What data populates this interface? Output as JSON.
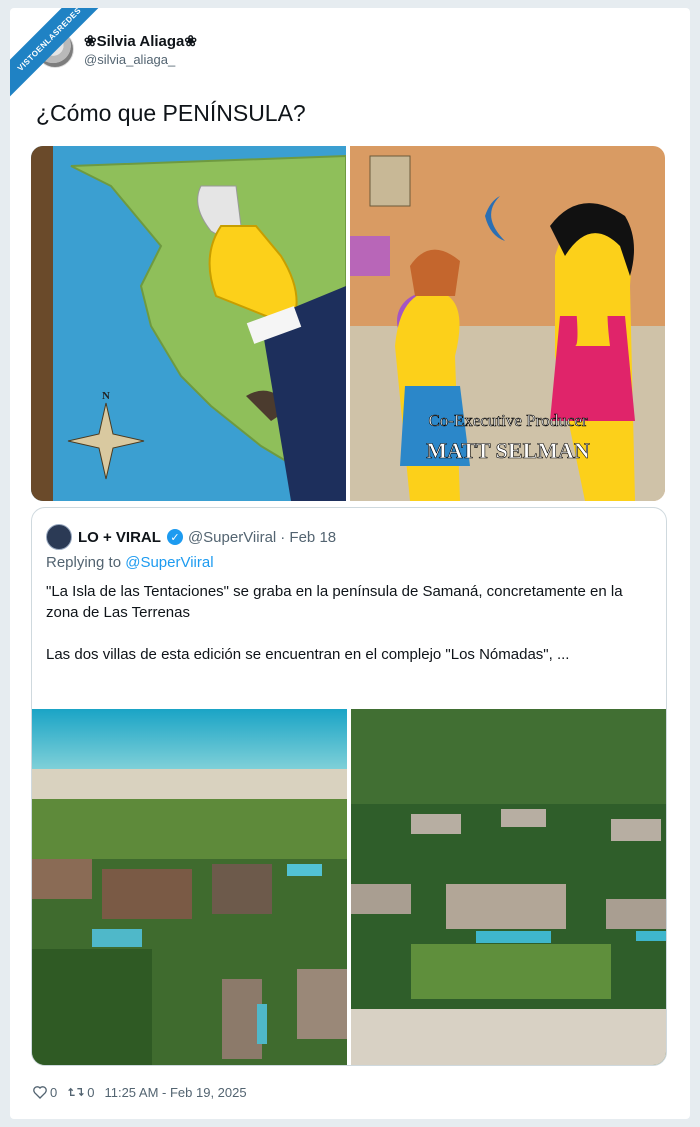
{
  "watermark": "VISTOENLASREDES",
  "author": {
    "display_name": "❀Silvia Aliaga❀",
    "handle": "@silvia_aliaga_"
  },
  "tweet": {
    "text": "¿Cómo que PENÍNSULA?",
    "images": [
      {
        "icon": "simpsons-map-image",
        "caption": ""
      },
      {
        "icon": "simpsons-credits-image",
        "caption_line1": "Co-Executive Producer",
        "caption_line2": "MATT SELMAN"
      }
    ]
  },
  "quoted": {
    "name": "LO + VIRAL",
    "handle": "@SuperViiral",
    "date": "· Feb 18",
    "replying_prefix": "Replying to",
    "replying_handle": "@SuperViiral",
    "paragraph1": "\"La Isla de las Tentaciones\" se graba en la península de Samaná, concretamente en la zona de Las Terrenas",
    "paragraph2": "Las dos villas de esta edición se encuentran en el complejo \"Los Nómadas\", ...",
    "images": [
      {
        "icon": "aerial-resort-beach-image"
      },
      {
        "icon": "aerial-resort-villas-image"
      }
    ]
  },
  "footer": {
    "likes": "0",
    "retweets": "0",
    "timestamp": "11:25 AM - Feb 19, 2025"
  },
  "colors": {
    "accent": "#1d9bf0",
    "watermark_bg": "#1f82c4"
  }
}
